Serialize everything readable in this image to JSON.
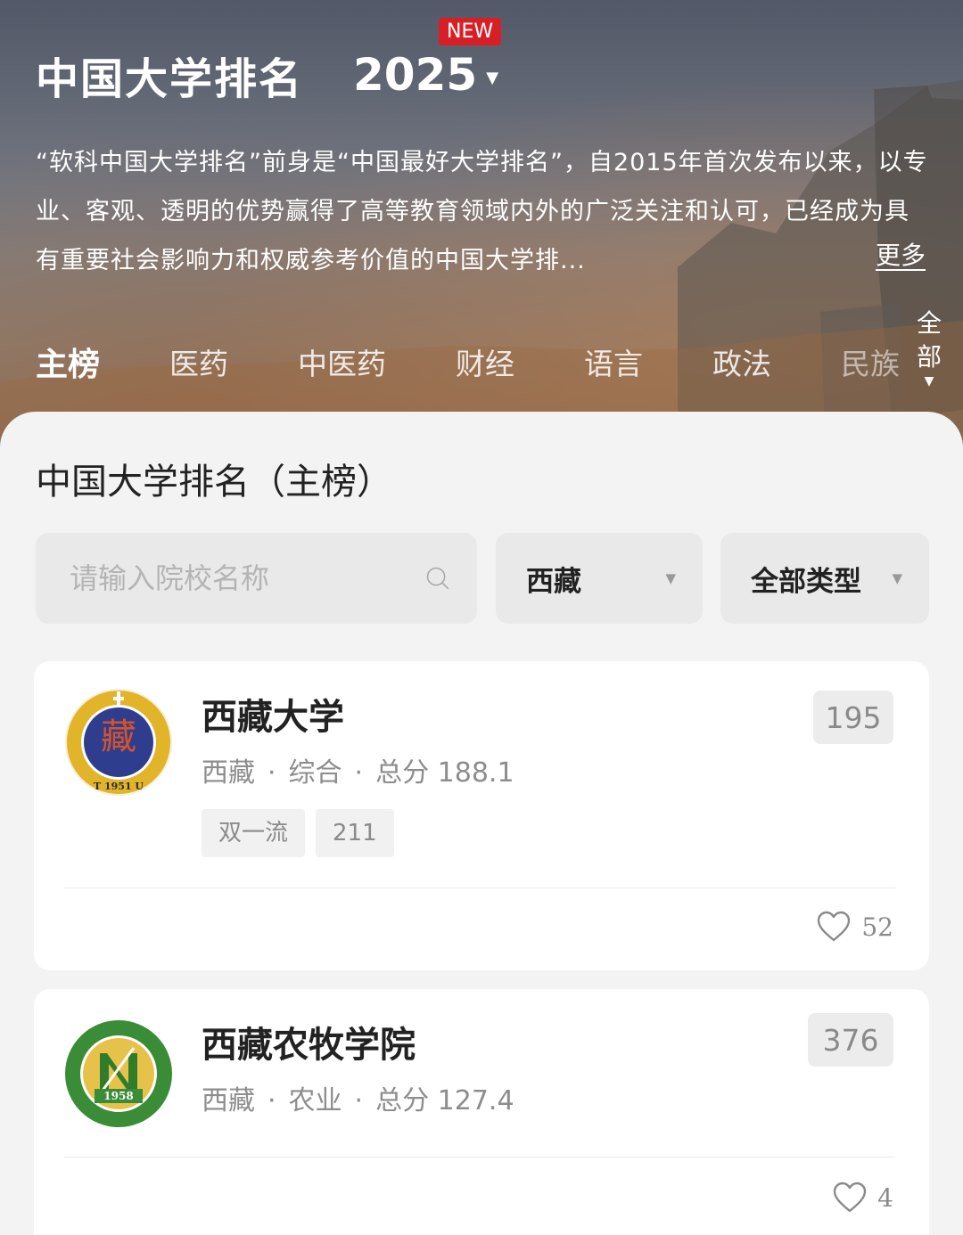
{
  "header": {
    "title": "中国大学排名",
    "year": "2025",
    "new_badge": "NEW",
    "intro_text": "“软科中国大学排名”前身是“中国最好大学排名”，自2015年首次发布以来，以专业、客观、透明的优势赢得了高等教育领域内外的广泛关注和认可，已经成为具有重要社会影响力和权威参考价值的中国大学排...",
    "more_label": "更多",
    "icons": {
      "year_dropdown": "caret-down-icon"
    }
  },
  "tabs": [
    {
      "label": "主榜",
      "active": true
    },
    {
      "label": "医药"
    },
    {
      "label": "中医药"
    },
    {
      "label": "财经"
    },
    {
      "label": "语言"
    },
    {
      "label": "政法"
    },
    {
      "label": "民族"
    }
  ],
  "all_tab": {
    "label_top": "全",
    "label_bottom": "部"
  },
  "section_title": "中国大学排名（主榜）",
  "filters": {
    "search_placeholder": "请输入院校名称",
    "search_value": "",
    "region": "西藏",
    "type": "全部类型",
    "icons": {
      "search": "search-icon",
      "dropdown": "caret-down-icon"
    }
  },
  "universities": [
    {
      "name": "西藏大学",
      "region": "西藏",
      "category": "综合",
      "score_label": "总分",
      "score": "188.1",
      "rank": "195",
      "tags": [
        "双一流",
        "211"
      ],
      "likes": "52",
      "logo_year": "T 1951 U",
      "logo_char": "藏",
      "colors": {
        "ring": "#e2b429",
        "core": "#2f3d8f",
        "glyph": "#d6532a"
      }
    },
    {
      "name": "西藏农牧学院",
      "region": "西藏",
      "category": "农业",
      "score_label": "总分",
      "score": "127.4",
      "rank": "376",
      "tags": [],
      "likes": "4",
      "logo_year": "1958",
      "colors": {
        "ring": "#3a8c37",
        "core": "#e7c24a",
        "glyph": "#2f7d2b"
      }
    }
  ],
  "icons": {
    "like": "heart-outline-icon"
  }
}
